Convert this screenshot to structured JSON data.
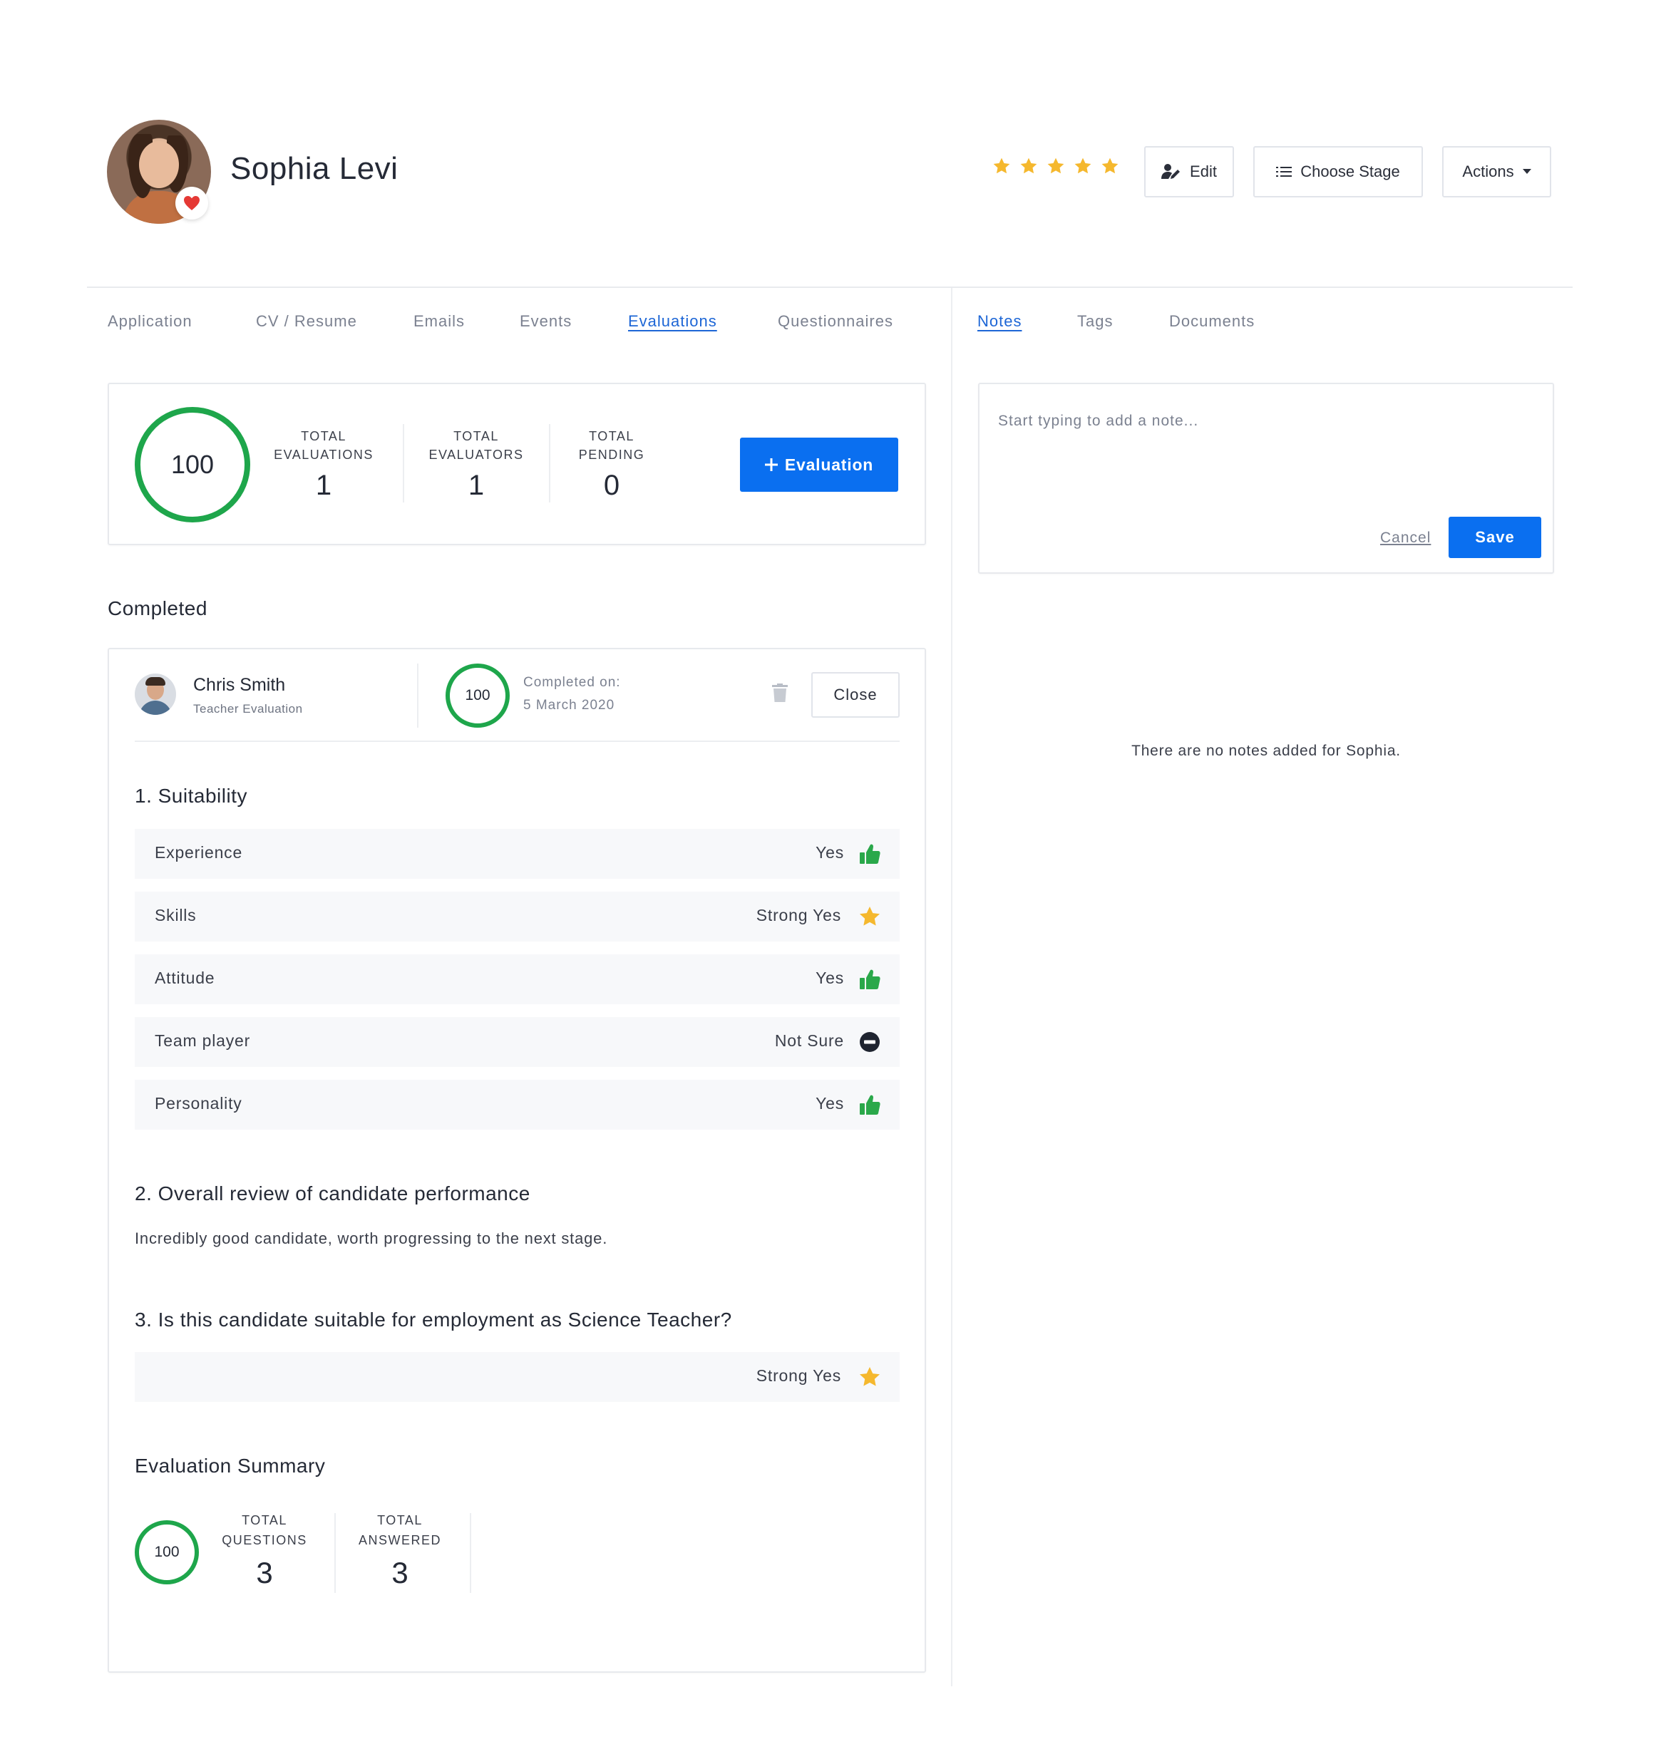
{
  "candidate": {
    "name": "Sophia Levi",
    "rating": 5,
    "rating_max": 5
  },
  "header_buttons": {
    "edit": "Edit",
    "choose_stage": "Choose Stage",
    "actions": "Actions"
  },
  "left_tabs": [
    {
      "label": "Application",
      "active": false
    },
    {
      "label": "CV / Resume",
      "active": false
    },
    {
      "label": "Emails",
      "active": false
    },
    {
      "label": "Events",
      "active": false
    },
    {
      "label": "Evaluations",
      "active": true
    },
    {
      "label": "Questionnaires",
      "active": false
    }
  ],
  "right_tabs": [
    {
      "label": "Notes",
      "active": true
    },
    {
      "label": "Tags",
      "active": false
    },
    {
      "label": "Documents",
      "active": false
    }
  ],
  "stats": {
    "score": "100",
    "total_evaluations_label_1": "TOTAL",
    "total_evaluations_label_2": "EVALUATIONS",
    "total_evaluations": "1",
    "total_evaluators_label_1": "TOTAL",
    "total_evaluators_label_2": "EVALUATORS",
    "total_evaluators": "1",
    "total_pending_label_1": "TOTAL",
    "total_pending_label_2": "PENDING",
    "total_pending": "0",
    "add_button": "Evaluation"
  },
  "completed_heading": "Completed",
  "evaluation": {
    "evaluator_name": "Chris Smith",
    "evaluation_type": "Teacher Evaluation",
    "score": "100",
    "completed_label": "Completed on:",
    "completed_date": "5 March 2020",
    "close_button": "Close",
    "q1": {
      "title": "1. Suitability",
      "rows": [
        {
          "label": "Experience",
          "answer": "Yes",
          "icon": "thumbs-up-icon"
        },
        {
          "label": "Skills",
          "answer": "Strong Yes",
          "icon": "star-icon"
        },
        {
          "label": "Attitude",
          "answer": "Yes",
          "icon": "thumbs-up-icon"
        },
        {
          "label": "Team player",
          "answer": "Not Sure",
          "icon": "minus-circle-icon"
        },
        {
          "label": "Personality",
          "answer": "Yes",
          "icon": "thumbs-up-icon"
        }
      ]
    },
    "q2": {
      "title": "2. Overall review of candidate performance",
      "answer": "Incredibly good candidate, worth progressing to the next stage."
    },
    "q3": {
      "title": "3. Is this candidate suitable for employment as Science Teacher?",
      "answer": "Strong Yes",
      "icon": "star-icon"
    },
    "summary": {
      "title": "Evaluation Summary",
      "score": "100",
      "total_questions_label_1": "TOTAL",
      "total_questions_label_2": "QUESTIONS",
      "total_questions": "3",
      "total_answered_label_1": "TOTAL",
      "total_answered_label_2": "ANSWERED",
      "total_answered": "3"
    }
  },
  "notes": {
    "placeholder": "Start typing to add a note...",
    "cancel": "Cancel",
    "save": "Save",
    "empty_message": "There are no notes added for Sophia."
  },
  "colors": {
    "primary": "#0a6ff0",
    "score_ring": "#1ea64b",
    "star": "#f5b82e",
    "thumbs_up": "#2aa84a",
    "heart": "#e53935",
    "active_tab": "#1d66d6"
  }
}
